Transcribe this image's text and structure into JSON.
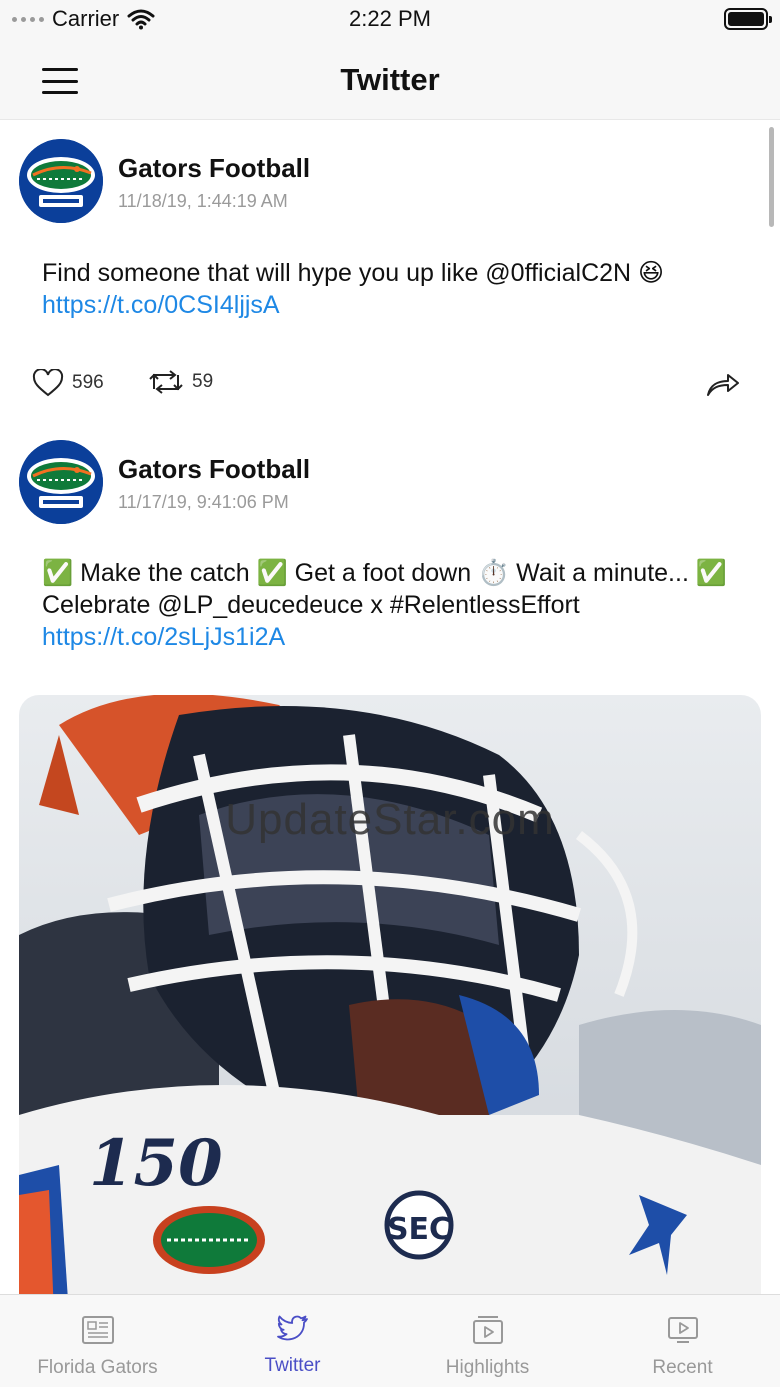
{
  "status": {
    "carrier": "Carrier",
    "time": "2:22 PM"
  },
  "nav": {
    "title": "Twitter"
  },
  "tweets": [
    {
      "author": "Gators Football",
      "date": "11/18/19, 1:44:19 AM",
      "text": "Find someone that will hype you up like @0fficialC2N 😆",
      "link": "https://t.co/0CSI4ljjsA",
      "likes": "596",
      "retweets": "59"
    },
    {
      "author": "Gators Football",
      "date": "11/17/19, 9:41:06 PM",
      "text": "✅ Make the catch ✅ Get a foot down ⏱️ Wait a minute... ✅ Celebrate @LP_deucedeuce x #RelentlessEffort",
      "link": "https://t.co/2sLjJs1i2A"
    }
  ],
  "media": {
    "jersey_number": "150",
    "patch": "SEC"
  },
  "watermark": "UpdateStar.com",
  "tabs": [
    {
      "label": "Florida Gators",
      "icon": "newspaper-icon"
    },
    {
      "label": "Twitter",
      "icon": "twitter-bird-icon",
      "active": true
    },
    {
      "label": "Highlights",
      "icon": "video-play-icon"
    },
    {
      "label": "Recent",
      "icon": "tv-play-icon"
    }
  ],
  "colors": {
    "link": "#1e88e5",
    "active_tab": "#4a4ec6",
    "inactive_tab": "#999999"
  }
}
